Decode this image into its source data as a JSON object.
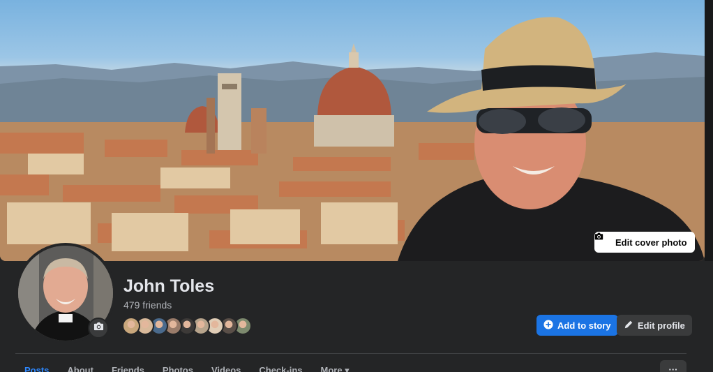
{
  "cover": {
    "edit_cover_label": "Edit cover photo"
  },
  "profile": {
    "name": "John Toles",
    "friends_count": "479 friends",
    "friend_face_colors": [
      "#c9a77c",
      "#d8b99a",
      "#4a6a8c",
      "#9a7c6a",
      "#3d3a38",
      "#b7a48c",
      "#e0cdb6",
      "#5a4f48",
      "#7d8a6e"
    ]
  },
  "actions": {
    "add_story_label": "Add to story",
    "edit_profile_label": "Edit profile"
  },
  "tabs": [
    {
      "label": "Posts",
      "active": true
    },
    {
      "label": "About",
      "active": false
    },
    {
      "label": "Friends",
      "active": false
    },
    {
      "label": "Photos",
      "active": false
    },
    {
      "label": "Videos",
      "active": false
    },
    {
      "label": "Check-ins",
      "active": false
    },
    {
      "label": "More ▾",
      "active": false
    }
  ],
  "more_menu_label": "···",
  "colors": {
    "accent": "#1b74e4",
    "active_tab": "#2d88ff",
    "background": "#242526"
  }
}
